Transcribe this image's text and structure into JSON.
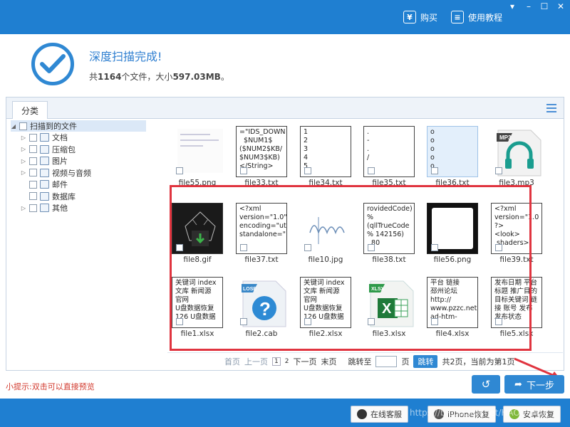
{
  "titlebar": {
    "buy_label": "购买",
    "tutorial_label": "使用教程"
  },
  "header": {
    "title": "深度扫描完成!",
    "summary_prefix": "共",
    "file_count": "1164",
    "summary_mid": "个文件，大小",
    "total_size": "597.03MB",
    "summary_suffix": "。"
  },
  "panel": {
    "tab_label": "分类"
  },
  "tree": {
    "root": "扫描到的文件",
    "items": [
      {
        "label": "文档",
        "icon": "document-icon",
        "expandable": true
      },
      {
        "label": "压缩包",
        "icon": "archive-icon",
        "expandable": true
      },
      {
        "label": "图片",
        "icon": "image-icon",
        "expandable": true
      },
      {
        "label": "视频与音频",
        "icon": "video-icon",
        "expandable": true
      },
      {
        "label": "邮件",
        "icon": "mail-icon",
        "expandable": false
      },
      {
        "label": "数据库",
        "icon": "database-icon",
        "expandable": false
      },
      {
        "label": "其他",
        "icon": "other-icon",
        "expandable": true
      }
    ]
  },
  "files": [
    {
      "name": "file55.png",
      "kind": "image-lightdoc",
      "lines": []
    },
    {
      "name": "file33.txt",
      "kind": "text",
      "lines": [
        "=\"IDS_DOWN",
        "  $NUM1$",
        "($NUM2$KB/",
        "$NUM3$KB)",
        "</String>"
      ]
    },
    {
      "name": "file34.txt",
      "kind": "text",
      "lines": [
        "1",
        "2",
        "3",
        "4",
        "5"
      ]
    },
    {
      "name": "file35.txt",
      "kind": "text",
      "lines": [
        ".",
        "-",
        ".",
        "/",
        ""
      ]
    },
    {
      "name": "file36.txt",
      "kind": "text-selected",
      "lines": [
        "o",
        "o",
        "o",
        "o",
        "o"
      ]
    },
    {
      "name": "file3.mp3",
      "kind": "mp3",
      "lines": []
    },
    {
      "name": "file8.gif",
      "kind": "dark-gif",
      "lines": []
    },
    {
      "name": "file37.txt",
      "kind": "text",
      "lines": [
        "<?xml",
        "version=\"1.0\"",
        "encoding=\"ut",
        "standalone=\""
      ]
    },
    {
      "name": "file10.jpg",
      "kind": "image-sketch",
      "lines": []
    },
    {
      "name": "file38.txt",
      "kind": "text",
      "lines": [
        "rovidedCode)",
        "%",
        "(qllTrueCode",
        "% 142156)",
        "  80"
      ]
    },
    {
      "name": "file56.png",
      "kind": "black",
      "lines": []
    },
    {
      "name": "file39.txt",
      "kind": "text",
      "lines": [
        "<?xml",
        "version=\"1.0",
        "?>",
        "<look>",
        " shaders>"
      ]
    },
    {
      "name": "file1.xlsx",
      "kind": "text",
      "lines": [
        "关键词 index",
        "文库 新闻源",
        "官网",
        "U盘数据恢复",
        "126 U盘数据"
      ]
    },
    {
      "name": "file2.cab",
      "kind": "lose",
      "lines": []
    },
    {
      "name": "file2.xlsx",
      "kind": "text",
      "lines": [
        "关键词 index",
        "文库 新闻源",
        "官网",
        "U盘数据恢复",
        "126 U盘数据"
      ]
    },
    {
      "name": "file3.xlsx",
      "kind": "excel",
      "lines": []
    },
    {
      "name": "file4.xlsx",
      "kind": "text",
      "lines": [
        "平台 链接",
        "邳州论坛",
        "http://",
        "www.pzzc.net,",
        "ad-htm-"
      ]
    },
    {
      "name": "file5.xlsx",
      "kind": "text",
      "lines": [
        "发布日期 平台",
        "标题 推广目的",
        "目标关键词 链",
        "接 账号 发布",
        "发布状态"
      ]
    }
  ],
  "pager": {
    "first": "首页",
    "prev": "上一页",
    "page1": "1",
    "page2": "2",
    "next": "下一页",
    "last": "末页",
    "jump_to": "跳转至",
    "page_unit": "页",
    "go": "跳转",
    "status": "共2页，当前为第1页"
  },
  "footer": {
    "tip": "小提示:双击可以直接预览",
    "next_label": "下一步"
  },
  "bottombar": {
    "online_service": "在线客服",
    "iphone_recovery": "iPhone恢复",
    "android_recovery": "安卓恢复",
    "watermark": "https://blog.csdn.net/HAOUMI01"
  },
  "colors": {
    "brand_blue": "#1f7fd1",
    "accent_blue": "#2f88d3",
    "highlight_red": "#e0343f",
    "tip_red": "#d23a2e"
  }
}
